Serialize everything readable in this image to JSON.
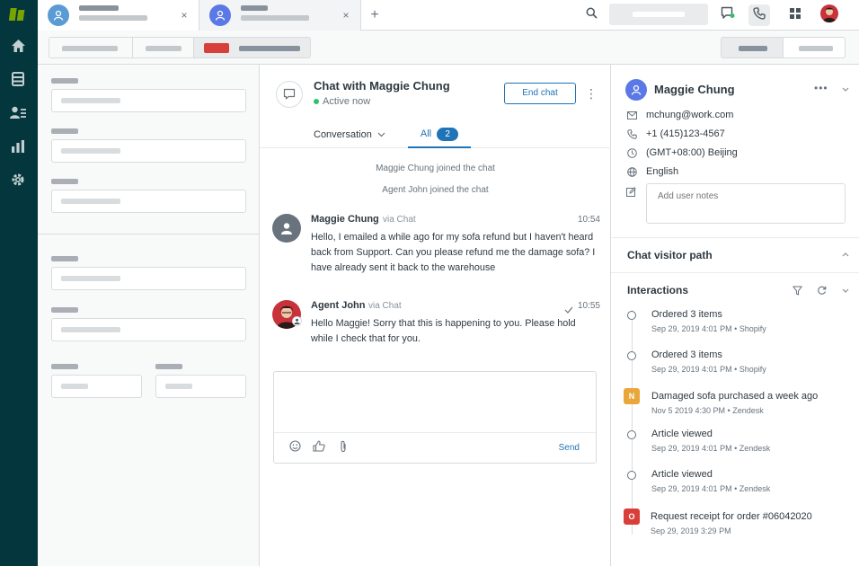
{
  "colors": {
    "nav_bg": "#03363d",
    "accent_blue": "#1f73b7",
    "status_green": "#2fbf71",
    "zendesk_event": "#e9a63b",
    "order_event": "#d93f3a",
    "tab_avatar_1": "#5a9bd5",
    "tab_avatar_2": "#5a78e6"
  },
  "nav": {
    "items": [
      {
        "icon": "home-icon"
      },
      {
        "icon": "views-icon"
      },
      {
        "icon": "customers-icon"
      },
      {
        "icon": "reporting-icon"
      },
      {
        "icon": "settings-icon"
      }
    ]
  },
  "topbar": {
    "add_tab_label": "+",
    "tab_close_label": "×",
    "icons": [
      "search-icon",
      "chat-notification-icon",
      "phone-icon",
      "apps-grid-icon"
    ]
  },
  "chat": {
    "title": "Chat with Maggie Chung",
    "status": "Active now",
    "end_chat_label": "End chat",
    "more_label": "⋮",
    "tabs": {
      "conversation_label": "Conversation",
      "all_label": "All",
      "all_count": "2"
    },
    "system_messages": [
      "Maggie Chung joined the chat",
      "Agent John joined the chat"
    ],
    "messages": [
      {
        "author": "Maggie Chung",
        "via": "via Chat",
        "time": "10:54",
        "text": "Hello, I emailed a while ago for my sofa refund but I haven't heard back from Support. Can you please refund me the damage sofa? I have already sent it back to the warehouse"
      },
      {
        "author": "Agent John",
        "via": "via Chat",
        "time": "10:55",
        "text": "Hello Maggie! Sorry that this is happening to you. Please hold while I check that for you."
      }
    ],
    "composer": {
      "send_label": "Send"
    }
  },
  "customer": {
    "name": "Maggie Chung",
    "more_label": "•••",
    "email": "mchung@work.com",
    "phone": "+1 (415)123-4567",
    "timezone": "(GMT+08:00) Beijing",
    "language": "English",
    "notes_placeholder": "Add user notes"
  },
  "sections": {
    "visitor_path_title": "Chat visitor path",
    "interactions_title": "Interactions"
  },
  "interactions": [
    {
      "title": "Ordered 3 items",
      "meta": "Sep 29, 2019 4:01 PM • Shopify",
      "kind": "circle",
      "badge": ""
    },
    {
      "title": "Ordered 3 items",
      "meta": "Sep 29, 2019 4:01 PM • Shopify",
      "kind": "circle",
      "badge": ""
    },
    {
      "title": "Damaged sofa purchased a week ago",
      "meta": "Nov 5 2019 4:30 PM • Zendesk",
      "kind": "square",
      "badge": "N"
    },
    {
      "title": "Article viewed",
      "meta": "Sep 29, 2019 4:01 PM • Zendesk",
      "kind": "circle",
      "badge": ""
    },
    {
      "title": "Article viewed",
      "meta": "Sep 29, 2019 4:01 PM • Zendesk",
      "kind": "circle",
      "badge": ""
    },
    {
      "title": "Request receipt for order #06042020",
      "meta": "Sep 29, 2019 3:29 PM",
      "kind": "square",
      "badge": "O"
    }
  ]
}
